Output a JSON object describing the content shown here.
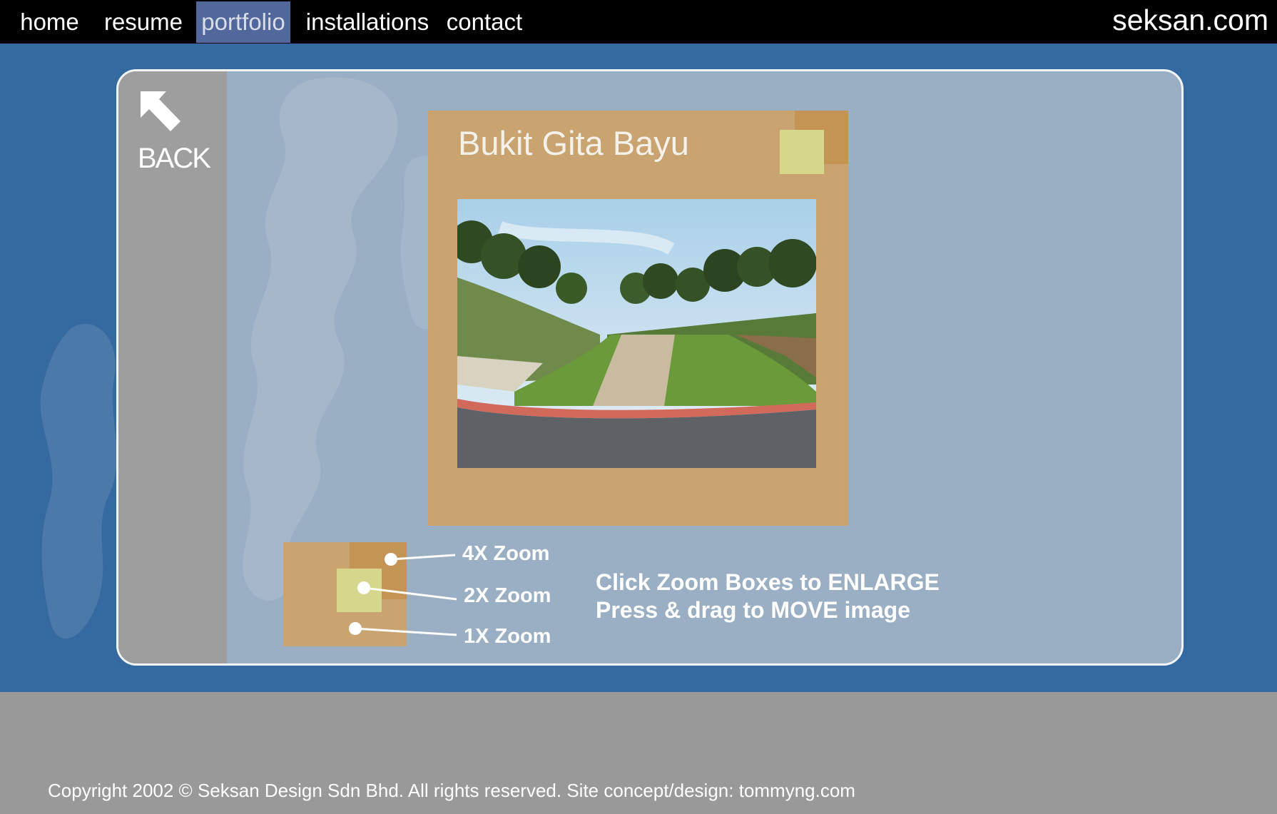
{
  "nav": {
    "items": [
      {
        "label": "home"
      },
      {
        "label": "resume"
      },
      {
        "label": "portfolio"
      },
      {
        "label": "installations"
      },
      {
        "label": "contact"
      }
    ],
    "active": "portfolio",
    "brand": "seksan.com"
  },
  "back": {
    "label": "BACK",
    "icon": "arrow-up-left-icon"
  },
  "project": {
    "title": "Bukit Gita Bayu",
    "photo_alt": "landscaped slope with stone drainage channel"
  },
  "zoom_legend": {
    "x4": "4X Zoom",
    "x2": "2X Zoom",
    "x1": "1X Zoom"
  },
  "instructions": {
    "line1": "Click Zoom Boxes to ENLARGE",
    "line2": "Press & drag to MOVE image"
  },
  "footer": {
    "copyright": "Copyright 2002 © Seksan Design Sdn Bhd. All rights reserved. Site concept/design: tommyng.com"
  },
  "colors": {
    "background": "#356aa0",
    "topbar": "#000000",
    "active_nav": "#52679c",
    "panel": "#9aafc4",
    "card": "#c9a370",
    "zoom_box": "#d6d68d",
    "footer": "#999999"
  }
}
